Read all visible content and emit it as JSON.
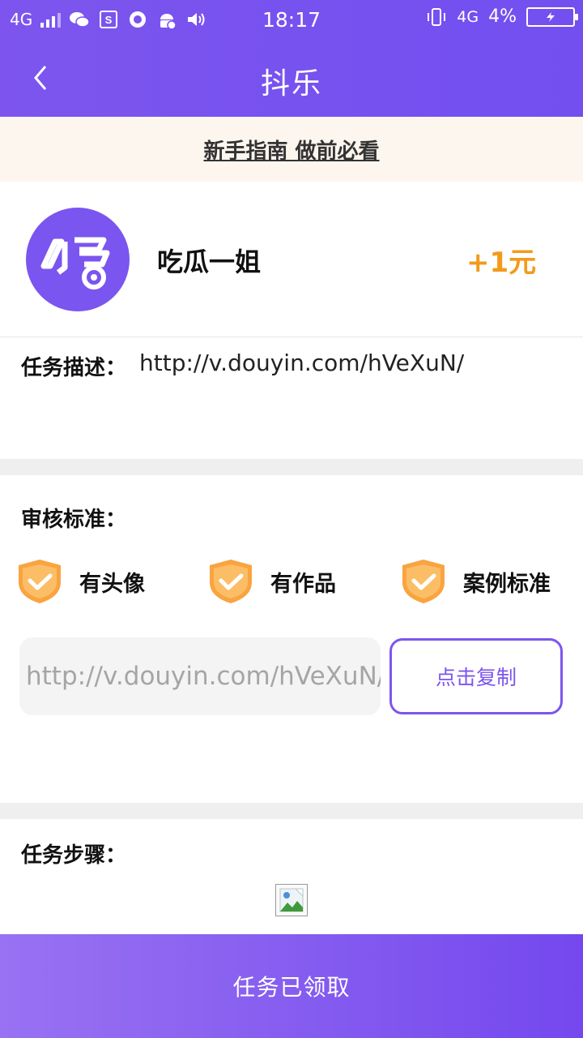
{
  "status_bar": {
    "network_left": "4G",
    "time": "18:17",
    "network_right": "4G",
    "battery": "4%"
  },
  "nav": {
    "title": "抖乐"
  },
  "guide": {
    "link": "新手指南 做前必看"
  },
  "task": {
    "name": "吃瓜一姐",
    "reward": "+1元",
    "desc_label": "任务描述：",
    "desc_value": "http://v.douyin.com/hVeXuN/"
  },
  "review": {
    "label": "审核标准：",
    "criteria": [
      "有头像",
      "有作品",
      "案例标准"
    ]
  },
  "copy": {
    "value": "http://v.douyin.com/hVeXuN/",
    "button": "点击复制"
  },
  "steps": {
    "label": "任务步骤："
  },
  "footer": {
    "button": "任务已领取"
  },
  "colors": {
    "primary": "#7d55ee",
    "reward": "#f39a1b",
    "shield": "#f9a441"
  }
}
